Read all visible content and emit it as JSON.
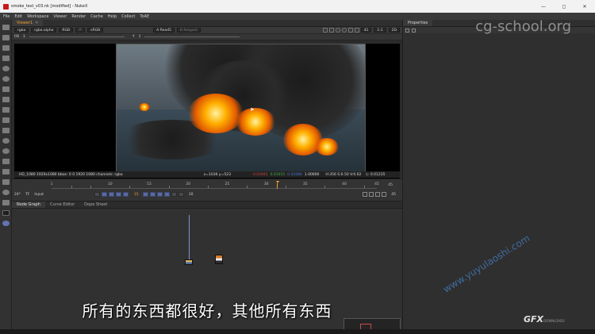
{
  "window": {
    "title": "smoke_test_v03.nk [modified] - NukeX",
    "min": "—",
    "max": "◻",
    "close": "✕"
  },
  "menu": [
    "File",
    "Edit",
    "Workspace",
    "Viewer",
    "Render",
    "Cache",
    "Help",
    "Collect",
    "ToAE"
  ],
  "viewer": {
    "tab": "Viewer1",
    "controls": {
      "channels": "rgba",
      "alpha": "rgba.alpha",
      "colorspace": "RGB",
      "ip": "IP",
      "lut": "sRGB",
      "input_a": "A  Read5",
      "input_b": "B  Retgat2",
      "zoom": "41",
      "proxy": "1:1",
      "mode": "2D"
    },
    "controls2": {
      "fstop": "f/8",
      "gain": "1",
      "gamma": "Y",
      "gamma_val": "1"
    },
    "info": {
      "format": "HD_1080 1920x1080  bbox: 0 0 1920 1080 channels: rgba",
      "coord": "x=1036 y=523",
      "r": "0.02945",
      "g": "0.01015",
      "b": "0.01080",
      "a": "1.00000",
      "hsv": "H:356 S:0.50 V:0.02",
      "lum": "L: 0.01235"
    }
  },
  "timeline": {
    "ticks": [
      "1",
      "10",
      "15",
      "20",
      "25",
      "30",
      "35",
      "40",
      "45"
    ],
    "end": "45",
    "fps": "24*",
    "tf": "TF",
    "input": "Input",
    "frame": "31",
    "step": "10",
    "range_end": "45"
  },
  "nodegraph": {
    "tabs": [
      "Node Graph",
      "Curve Editor",
      "Dope Sheet"
    ],
    "subtitle": "所有的东西都很好，其他所有东西"
  },
  "properties": {
    "tab": "Properties",
    "logo": "cg-school.org"
  },
  "watermark": "www.yuyulaoshi.com",
  "corner_logo": "GFX",
  "corner_logo_sub": "DOWNLOADS"
}
